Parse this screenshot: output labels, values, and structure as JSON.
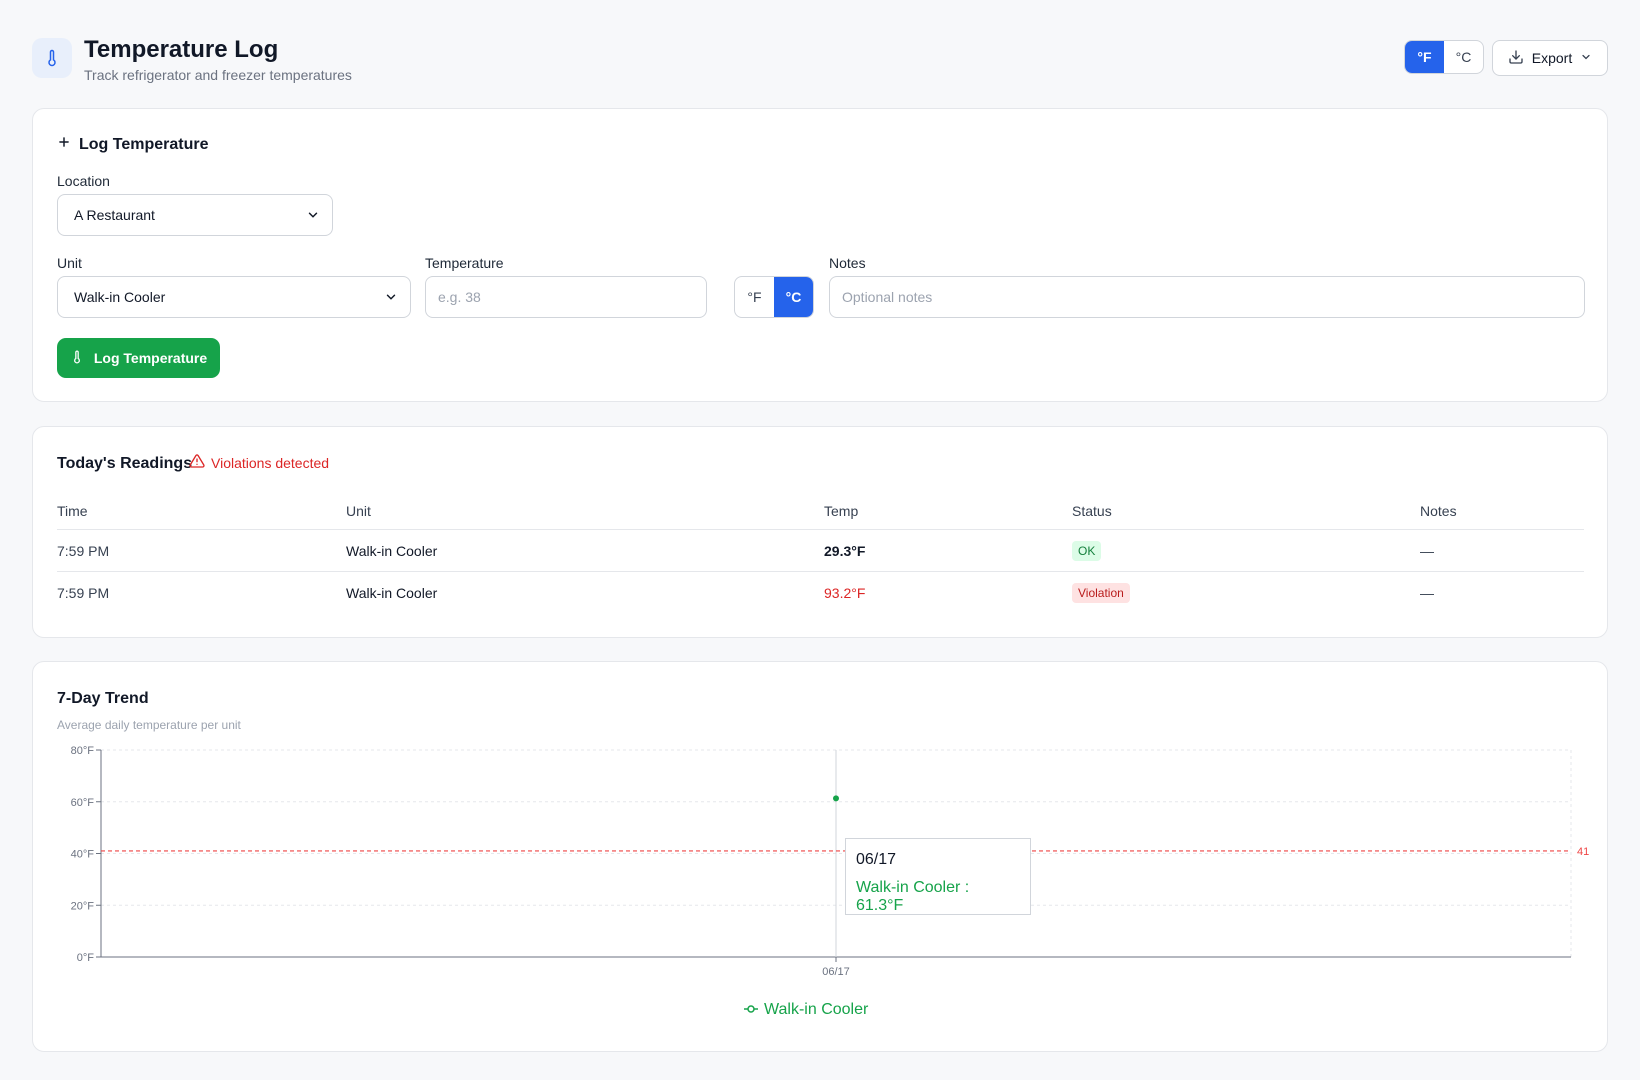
{
  "header": {
    "title": "Temperature Log",
    "subtitle": "Track refrigerator and freezer temperatures",
    "unit_f": "°F",
    "unit_c": "°C",
    "export_label": "Export"
  },
  "log_form": {
    "title": "Log Temperature",
    "location_label": "Location",
    "location_value": "A Restaurant",
    "unit_label": "Unit",
    "unit_value": "Walk-in Cooler",
    "temp_label": "Temperature",
    "temp_placeholder": "e.g. 38",
    "temp_unit_f": "°F",
    "temp_unit_c": "°C",
    "notes_label": "Notes",
    "notes_placeholder": "Optional notes",
    "submit_label": "Log Temperature"
  },
  "readings": {
    "title": "Today's Readings",
    "violation_text": "Violations detected",
    "columns": [
      "Time",
      "Unit",
      "Temp",
      "Status",
      "Notes"
    ],
    "rows": [
      {
        "time": "7:59 PM",
        "unit": "Walk-in Cooler",
        "temp": "29.3°F",
        "status": "OK",
        "notes": "—"
      },
      {
        "time": "7:59 PM",
        "unit": "Walk-in Cooler",
        "temp": "93.2°F",
        "status": "Violation",
        "notes": "—"
      }
    ]
  },
  "trend": {
    "title": "7-Day Trend",
    "subtitle": "Average daily temperature per unit",
    "tooltip_date": "06/17",
    "tooltip_value": "Walk-in Cooler : 61.3°F",
    "legend": "Walk-in Cooler",
    "threshold_label": "41"
  },
  "colors": {
    "accent": "#2563eb",
    "success": "#16a34a",
    "danger": "#dc2626"
  },
  "chart_data": {
    "type": "line",
    "x": [
      "06/17"
    ],
    "series": [
      {
        "name": "Walk-in Cooler",
        "values": [
          61.3
        ]
      }
    ],
    "ylim": [
      0,
      80
    ],
    "yticks": [
      "0°F",
      "20°F",
      "40°F",
      "60°F",
      "80°F"
    ],
    "threshold": 41,
    "grid": true,
    "legend": "bottom"
  }
}
